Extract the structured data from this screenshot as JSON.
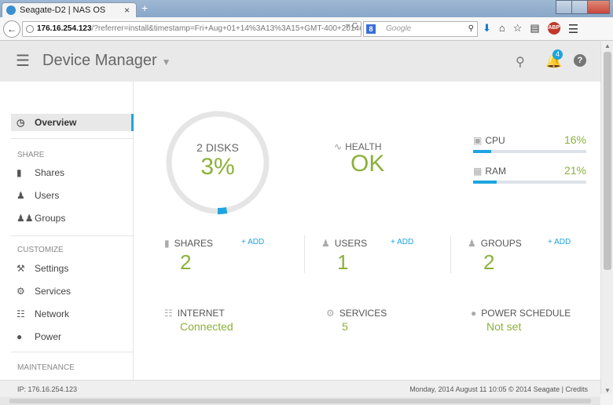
{
  "browser": {
    "tab_title": "Seagate-D2 | NAS OS",
    "tab_close": "×",
    "new_tab": "+",
    "url_host": "176.16.254.123",
    "url_rest": "/?referrer=install&timestamp=Fri+Aug+01+14%3A13%3A15+GMT-400+2014#devi",
    "search_engine_label": "8",
    "search_placeholder": "Google"
  },
  "app": {
    "title": "Device Manager",
    "notification_count": "4"
  },
  "sidebar": {
    "overview": "Overview",
    "sections": {
      "share": "SHARE",
      "customize": "CUSTOMIZE",
      "maintenance": "MAINTENANCE"
    },
    "share_items": [
      {
        "label": "Shares"
      },
      {
        "label": "Users"
      },
      {
        "label": "Groups"
      }
    ],
    "customize_items": [
      {
        "label": "Settings"
      },
      {
        "label": "Services"
      },
      {
        "label": "Network"
      },
      {
        "label": "Power"
      }
    ]
  },
  "dashboard": {
    "disks": {
      "label": "2 DISKS",
      "value": "3%",
      "usage_fraction": 0.03
    },
    "health": {
      "label": "HEALTH",
      "value": "OK"
    },
    "cpu": {
      "label": "CPU",
      "value": "16%",
      "percent": 16
    },
    "ram": {
      "label": "RAM",
      "value": "21%",
      "percent": 21
    },
    "shares": {
      "label": "SHARES",
      "add": "+ ADD",
      "value": "2"
    },
    "users": {
      "label": "USERS",
      "add": "+ ADD",
      "value": "1"
    },
    "groups": {
      "label": "GROUPS",
      "add": "+ ADD",
      "value": "2"
    },
    "internet": {
      "label": "INTERNET",
      "value": "Connected"
    },
    "services": {
      "label": "SERVICES",
      "value": "5"
    },
    "power_schedule": {
      "label": "POWER SCHEDULE",
      "value": "Not set"
    }
  },
  "footer": {
    "ip": "IP: 176.16.254.123",
    "datetime": "Monday, 2014 August 11  10:05",
    "copyright": "© 2014 Seagate | Credits"
  },
  "colors": {
    "accent_green": "#8bb13a",
    "accent_blue": "#1ea4e0",
    "ring_track": "#e5e5e5"
  }
}
